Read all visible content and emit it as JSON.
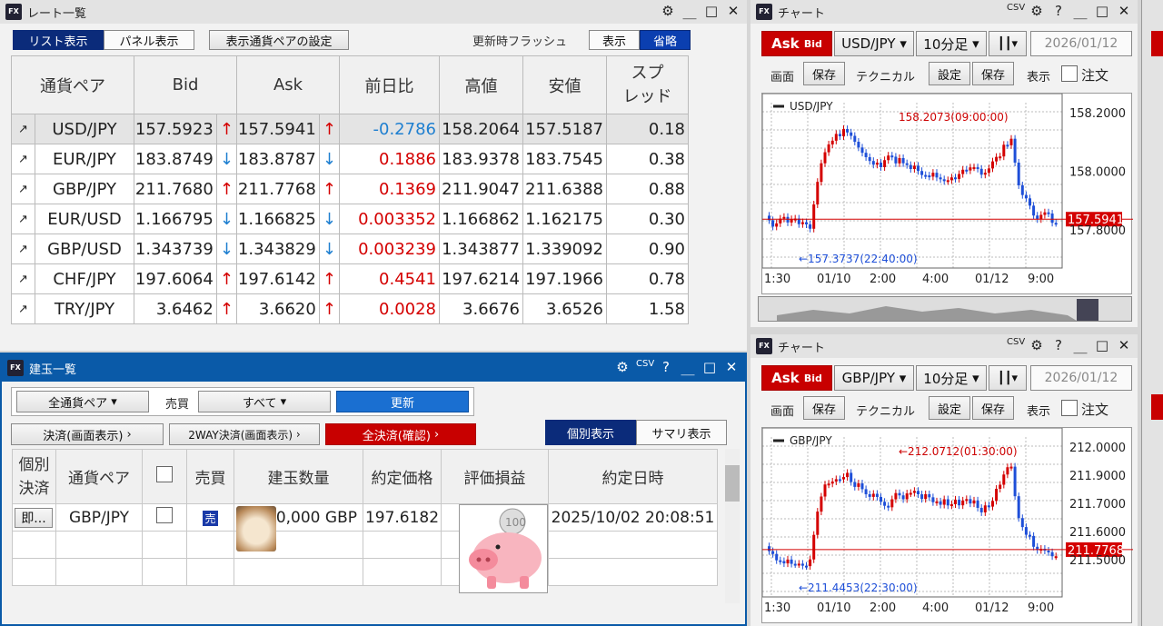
{
  "rate": {
    "title": "レート一覧",
    "tab_list": "リスト表示",
    "tab_panel": "パネル表示",
    "setting": "表示通貨ペアの設定",
    "flash_label": "更新時フラッシュ",
    "flash_show": "表示",
    "flash_omit": "省略",
    "headers": [
      "通貨ペア",
      "Bid",
      "Ask",
      "前日比",
      "高値",
      "安値",
      "スプ",
      "レッド"
    ],
    "rows": [
      {
        "pair": "USD/JPY",
        "bid": "157.5923",
        "bd": "up",
        "ask": "157.5941",
        "ad": "up",
        "chg": "-0.2786",
        "cs": "neg",
        "high": "158.2064",
        "low": "157.5187",
        "spread": "0.18"
      },
      {
        "pair": "EUR/JPY",
        "bid": "183.8749",
        "bd": "dn",
        "ask": "183.8787",
        "ad": "dn",
        "chg": "0.1886",
        "cs": "pos",
        "high": "183.9378",
        "low": "183.7545",
        "spread": "0.38"
      },
      {
        "pair": "GBP/JPY",
        "bid": "211.7680",
        "bd": "up",
        "ask": "211.7768",
        "ad": "up",
        "chg": "0.1369",
        "cs": "pos",
        "high": "211.9047",
        "low": "211.6388",
        "spread": "0.88"
      },
      {
        "pair": "EUR/USD",
        "bid": "1.166795",
        "bd": "dn",
        "ask": "1.166825",
        "ad": "dn",
        "chg": "0.003352",
        "cs": "pos",
        "high": "1.166862",
        "low": "1.162175",
        "spread": "0.30"
      },
      {
        "pair": "GBP/USD",
        "bid": "1.343739",
        "bd": "dn",
        "ask": "1.343829",
        "ad": "dn",
        "chg": "0.003239",
        "cs": "pos",
        "high": "1.343877",
        "low": "1.339092",
        "spread": "0.90"
      },
      {
        "pair": "CHF/JPY",
        "bid": "197.6064",
        "bd": "up",
        "ask": "197.6142",
        "ad": "up",
        "chg": "0.4541",
        "cs": "pos",
        "high": "197.6214",
        "low": "197.1966",
        "spread": "0.78"
      },
      {
        "pair": "TRY/JPY",
        "bid": "3.6462",
        "bd": "up",
        "ask": "3.6620",
        "ad": "up",
        "chg": "0.0028",
        "cs": "pos",
        "high": "3.6676",
        "low": "3.6526",
        "spread": "1.58"
      }
    ]
  },
  "pos": {
    "title": "建玉一覧",
    "pair_select": "全通貨ペア",
    "side_label": "売買",
    "side_select": "すべて",
    "refresh": "更新",
    "settle": "決済(画面表示)",
    "twoway": "2WAY決済(画面表示)",
    "allsettle": "全決済(確認)",
    "view_each": "個別表示",
    "view_sum": "サマリ表示",
    "headers": [
      "個別",
      "決済",
      "通貨ペア",
      "売買",
      "建玉数量",
      "約定価格",
      "評価損益",
      "約定日時"
    ],
    "row": {
      "btn": "即...",
      "pair": "GBP/JPY",
      "side": "売",
      "qty": "0,000 GBP",
      "price": "197.6182",
      "date": "2025/10/02 20:08:51"
    }
  },
  "chart1": {
    "title": "チャート",
    "ask": "Ask",
    "bid": "Bid",
    "pair": "USD/JPY",
    "tf": "10分足",
    "date": "2026/01/12",
    "lbl_screen": "画面",
    "save": "保存",
    "technical": "テクニカル",
    "setting": "設定",
    "display": "表示",
    "order": "注文",
    "series": "USD/JPY",
    "high_ann": "158.2073(09:00:00)",
    "low_ann": "←157.3737(22:40:00)",
    "last": "157.5941",
    "yticks": [
      "158.2000",
      "158.0000",
      "157.8000"
    ],
    "xticks": [
      "1:30",
      "01/10",
      "2:00",
      "4:00",
      "01/12",
      "9:00"
    ]
  },
  "chart2": {
    "title": "チャート",
    "ask": "Ask",
    "bid": "Bid",
    "pair": "GBP/JPY",
    "tf": "10分足",
    "date": "2026/01/12",
    "lbl_screen": "画面",
    "save": "保存",
    "technical": "テクニカル",
    "setting": "設定",
    "display": "表示",
    "order": "注文",
    "series": "GBP/JPY",
    "high_ann": "←212.0712(01:30:00)",
    "low_ann": "←211.4453(22:30:00)",
    "last": "211.7768",
    "yticks": [
      "212.0000",
      "211.9000",
      "211.7000",
      "211.6000",
      "211.5000"
    ],
    "xticks": [
      "1:30",
      "01/10",
      "2:00",
      "4:00",
      "01/12",
      "9:00"
    ]
  },
  "colors": {
    "up": "#d40000",
    "down": "#1e4fd8"
  }
}
